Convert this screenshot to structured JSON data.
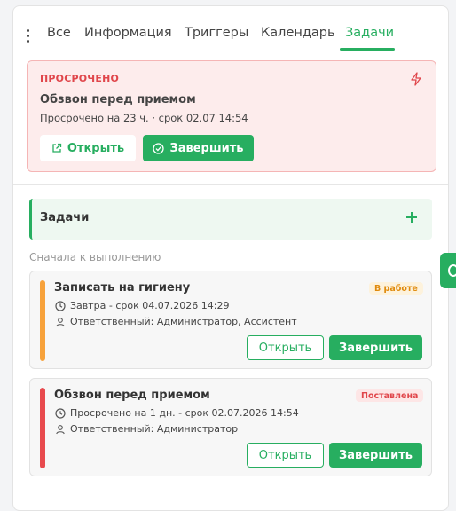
{
  "tabs": {
    "items": [
      {
        "label": "Все"
      },
      {
        "label": "Информация"
      },
      {
        "label": "Триггеры"
      },
      {
        "label": "Календарь"
      },
      {
        "label": "Задачи"
      }
    ],
    "active": "Задачи"
  },
  "overdue": {
    "label": "ПРОСРОЧЕНО",
    "title": "Обзвон перед приемом",
    "subtitle": "Просрочено на 23 ч. · срок 02.07 14:54",
    "open_label": "Открыть",
    "complete_label": "Завершить"
  },
  "tasks_section": {
    "title": "Задачи",
    "sort_label": "Сначала к выполнению"
  },
  "tasks": [
    {
      "title": "Записать на гигиену",
      "status": "В работе",
      "status_text_color": "#e08a0c",
      "status_bg_color": "#fdf2dc",
      "stripe_color": "#f7a23b",
      "due": "Завтра - срок 04.07.2026 14:29",
      "assignee": "Ответственный: Администратор, Ассистент",
      "open_label": "Открыть",
      "complete_label": "Завершить"
    },
    {
      "title": "Обзвон перед приемом",
      "status": "Поставлена",
      "status_text_color": "#e0464b",
      "status_bg_color": "#fde6e6",
      "stripe_color": "#e84a4e",
      "due": "Просрочено на 1 дн. - срок 02.07.2026 14:54",
      "assignee": "Ответственный: Администратор",
      "open_label": "Открыть",
      "complete_label": "Завершить"
    }
  ],
  "colors": {
    "accent": "#27ae60",
    "danger": "#e0464b"
  },
  "icons": [
    "more-vertical-icon",
    "lightning-icon",
    "external-link-icon",
    "check-circle-icon",
    "plus-icon",
    "clock-icon",
    "user-icon",
    "side-widget-icon"
  ]
}
